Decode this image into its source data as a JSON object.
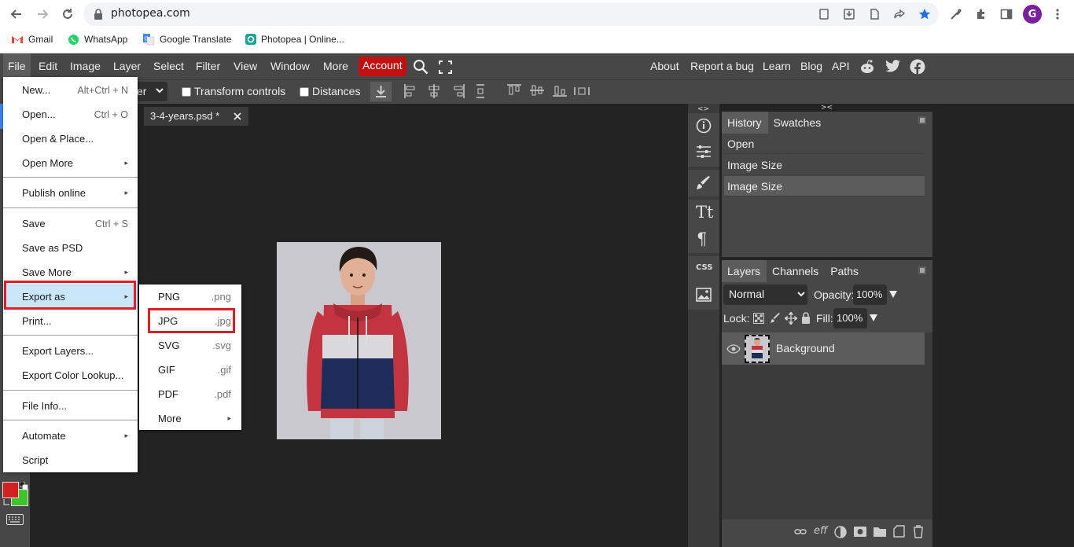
{
  "browser": {
    "url": "photopea.com",
    "profile_initial": "G",
    "bookmarks": [
      "Gmail",
      "WhatsApp",
      "Google Translate",
      "Photopea | Online..."
    ]
  },
  "menubar": {
    "items": [
      "File",
      "Edit",
      "Image",
      "Layer",
      "Select",
      "Filter",
      "View",
      "Window",
      "More"
    ],
    "account": "Account",
    "right_links": [
      "About",
      "Report a bug",
      "Learn",
      "Blog",
      "API"
    ]
  },
  "options": {
    "dropdown_tail": "er",
    "transform_controls": "Transform controls",
    "distances": "Distances"
  },
  "document": {
    "tab_title": "3-4-years.psd *"
  },
  "file_menu": {
    "items": [
      {
        "label": "New...",
        "shortcut": "Alt+Ctrl + N"
      },
      {
        "label": "Open...",
        "shortcut": "Ctrl + O"
      },
      {
        "label": "Open & Place...",
        "shortcut": ""
      },
      {
        "label": "Open More",
        "shortcut": ""
      },
      {
        "label": "Publish online",
        "shortcut": ""
      },
      {
        "label": "Save",
        "shortcut": "Ctrl + S"
      },
      {
        "label": "Save as PSD",
        "shortcut": ""
      },
      {
        "label": "Save More",
        "shortcut": ""
      },
      {
        "label": "Export as",
        "shortcut": ""
      },
      {
        "label": "Print...",
        "shortcut": ""
      },
      {
        "label": "Export Layers...",
        "shortcut": ""
      },
      {
        "label": "Export Color Lookup...",
        "shortcut": ""
      },
      {
        "label": "File Info...",
        "shortcut": ""
      },
      {
        "label": "Automate",
        "shortcut": ""
      },
      {
        "label": "Script",
        "shortcut": ""
      }
    ],
    "submenu_arrow": "▸"
  },
  "export_submenu": {
    "items": [
      {
        "label": "PNG",
        "ext": ".png"
      },
      {
        "label": "JPG",
        "ext": ".jpg"
      },
      {
        "label": "SVG",
        "ext": ".svg"
      },
      {
        "label": "GIF",
        "ext": ".gif"
      },
      {
        "label": "PDF",
        "ext": ".pdf"
      },
      {
        "label": "More",
        "ext": ""
      }
    ]
  },
  "history_panel": {
    "tabs": [
      "History",
      "Swatches"
    ],
    "entries": [
      "Open",
      "Image Size",
      "Image Size"
    ]
  },
  "layers_panel": {
    "tabs": [
      "Layers",
      "Channels",
      "Paths"
    ],
    "blend_mode": "Normal",
    "opacity_label": "Opacity:",
    "opacity_value": "100%",
    "lock_label": "Lock:",
    "fill_label": "Fill:",
    "fill_value": "100%",
    "layers": [
      "Background"
    ],
    "footer_eff": "eff"
  },
  "side_strip": {
    "css_label": "CSS"
  },
  "colors": {
    "foreground": "#d42020",
    "background": "#3ec42a",
    "highlight": "#c9e6fb",
    "outline": "#d9202b"
  }
}
